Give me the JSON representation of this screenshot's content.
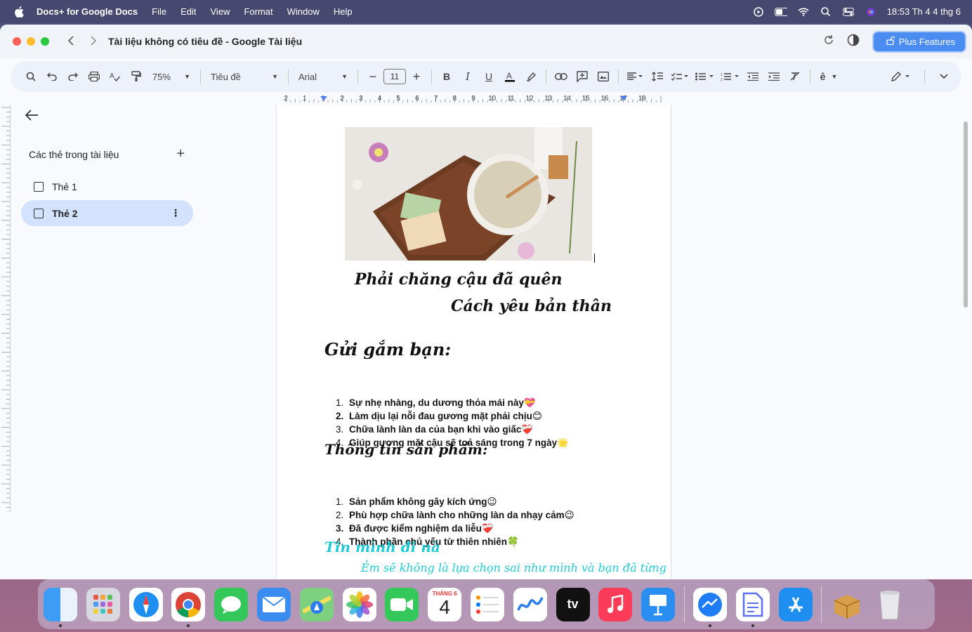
{
  "menubar": {
    "app_name": "Docs+ for Google Docs",
    "menus": [
      "File",
      "Edit",
      "View",
      "Format",
      "Window",
      "Help"
    ],
    "clock": "18:53 Th 4 4 thg 6"
  },
  "window": {
    "title": "Tài liệu không có tiêu đề - Google Tài liệu",
    "plus_features_label": "Plus Features"
  },
  "toolbar": {
    "zoom": "75%",
    "style": "Tiêu đề",
    "font": "Arial",
    "font_size": "11"
  },
  "ruler": {
    "labels": [
      "2",
      "1",
      "1",
      "2",
      "3",
      "4",
      "5",
      "6",
      "7",
      "8",
      "9",
      "10",
      "11",
      "12",
      "13",
      "14",
      "15",
      "16",
      "17",
      "18"
    ]
  },
  "sidebar": {
    "header": "Các thẻ trong tài liệu",
    "tabs": [
      {
        "label": "Thẻ 1"
      },
      {
        "label": "Thẻ 2"
      }
    ]
  },
  "document": {
    "heading_line1": "Phải chăng cậu đã quên",
    "heading_line2": "Cách yêu bản thân",
    "section1_title": "Gửi gắm bạn:",
    "section1_items": [
      "Sự nhẹ nhàng, du dương thỏa mái này💝",
      "Làm dịu lại nỗi đau gương mặt phải chịu😊",
      "Chữa lành làn da của bạn khi vào giấc❤️‍🩹",
      "Giúp gương mặt cậu sẽ toả sáng trong 7 ngày🌟"
    ],
    "section2_title": "Thông tin sản phẩm:",
    "section2_items": [
      "Sản phẩm không gây kích ứng😉",
      "Phù hợp chữa lành cho những làn da nhạy cảm😉",
      "Đã được kiểm nghiệm da liễu❤️‍🩹",
      "Thành phần chủ yếu từ thiên nhiên🍀"
    ],
    "section3_title": "Tin mình đi nà",
    "section3_line": "Ẻm sẽ không là lựa chọn sai như mình và bạn đã từng"
  },
  "dock": {
    "calendar_month": "THÁNG 6",
    "calendar_day": "4",
    "tv_label": "tv"
  },
  "colors": {
    "accent_blue": "#4a8cf0",
    "tab_active_bg": "#d3e3fd",
    "cyan_text": "#1fc9d6"
  }
}
